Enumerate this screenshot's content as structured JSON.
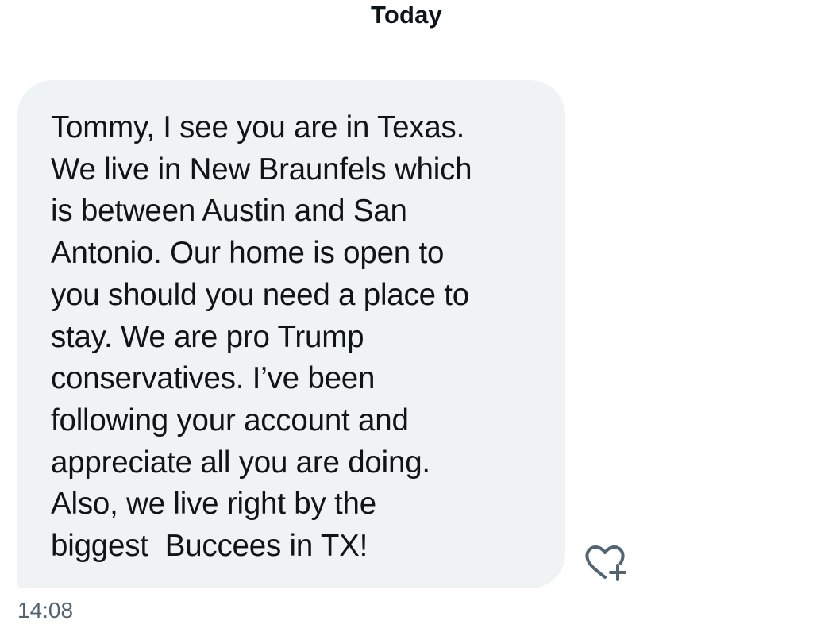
{
  "conversation": {
    "date_divider": "Today"
  },
  "message": {
    "lines": [
      "Tommy, I see you are in Texas.",
      "We live in New Braunfels which",
      "is between Austin and San",
      "Antonio. Our home is open to",
      "you should you need a place to",
      "stay. We are pro Trump",
      "conservatives. I’ve been",
      "following your account and",
      "appreciate all you are doing.",
      "Also, we live right by the",
      "biggest  Buccees in TX!"
    ],
    "timestamp": "14:08",
    "reaction_icon": "heart-plus-icon"
  },
  "colors": {
    "bubble_background": "#eff3f4",
    "text": "#0f1419",
    "secondary_text": "#536471",
    "icon": "#536471"
  }
}
